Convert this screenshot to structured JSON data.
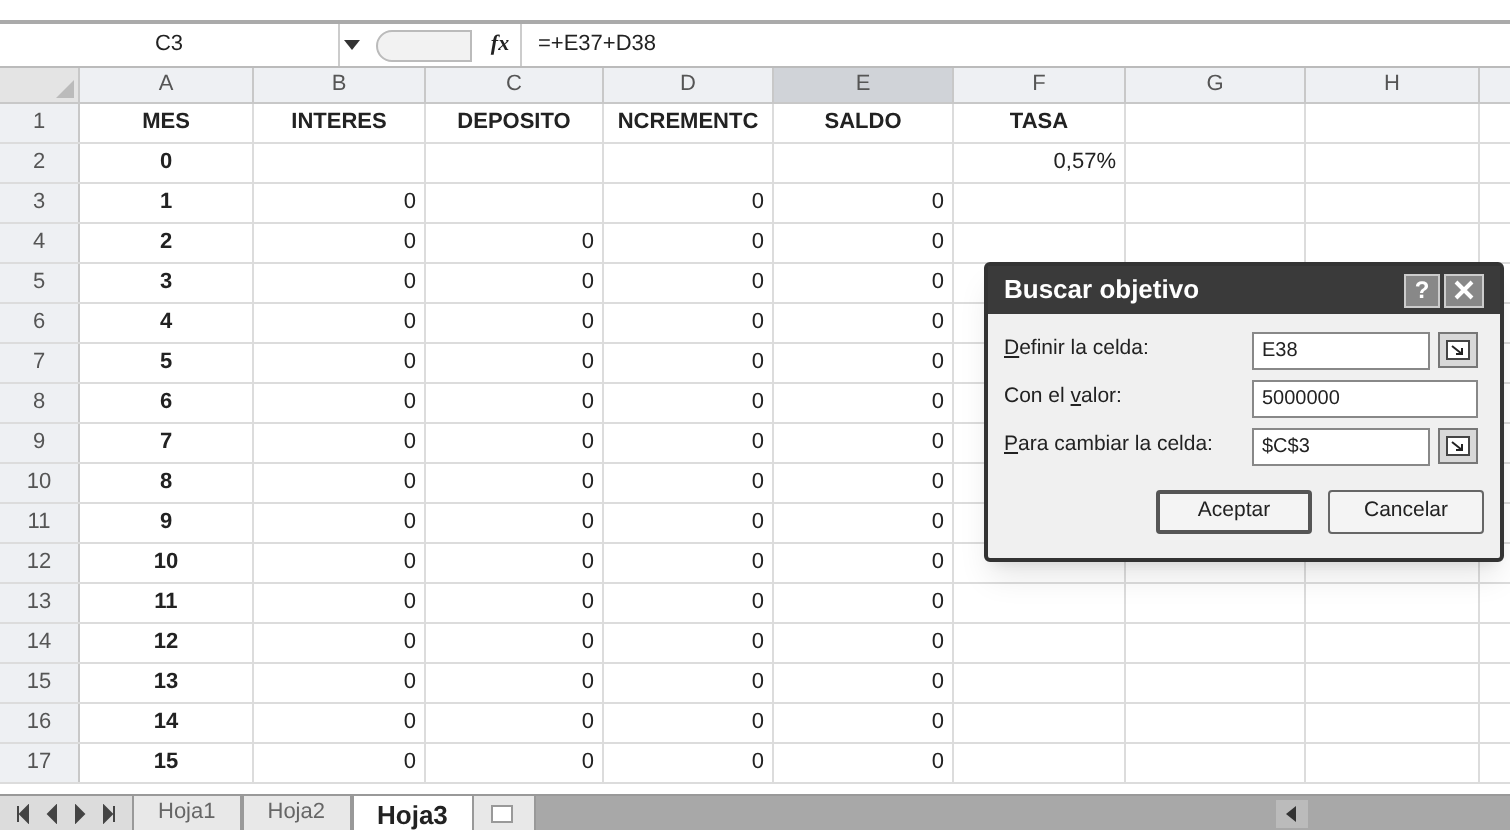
{
  "formula_bar": {
    "name_box": "C3",
    "function_label": "fx",
    "formula": "=+E37+D38"
  },
  "columns": [
    {
      "label": "A",
      "selected": false
    },
    {
      "label": "B",
      "selected": false
    },
    {
      "label": "C",
      "selected": false
    },
    {
      "label": "D",
      "selected": false
    },
    {
      "label": "E",
      "selected": true
    },
    {
      "label": "F",
      "selected": false
    },
    {
      "label": "G",
      "selected": false
    },
    {
      "label": "H",
      "selected": false
    }
  ],
  "rows": [
    {
      "number": "1",
      "cells": {
        "A": "MES",
        "B": "INTERES",
        "C": "DEPOSITO",
        "D": "NCREMENTC",
        "E": "SALDO",
        "F": "TASA"
      }
    },
    {
      "number": "2",
      "cells": {
        "A": "0",
        "F": "0,57%"
      }
    },
    {
      "number": "3",
      "cells": {
        "A": "1",
        "B": "0",
        "D": "0",
        "E": "0"
      }
    },
    {
      "number": "4",
      "cells": {
        "A": "2",
        "B": "0",
        "C": "0",
        "D": "0",
        "E": "0"
      }
    },
    {
      "number": "5",
      "cells": {
        "A": "3",
        "B": "0",
        "C": "0",
        "D": "0",
        "E": "0"
      }
    },
    {
      "number": "6",
      "cells": {
        "A": "4",
        "B": "0",
        "C": "0",
        "D": "0",
        "E": "0"
      }
    },
    {
      "number": "7",
      "cells": {
        "A": "5",
        "B": "0",
        "C": "0",
        "D": "0",
        "E": "0"
      }
    },
    {
      "number": "8",
      "cells": {
        "A": "6",
        "B": "0",
        "C": "0",
        "D": "0",
        "E": "0"
      }
    },
    {
      "number": "9",
      "cells": {
        "A": "7",
        "B": "0",
        "C": "0",
        "D": "0",
        "E": "0"
      }
    },
    {
      "number": "10",
      "cells": {
        "A": "8",
        "B": "0",
        "C": "0",
        "D": "0",
        "E": "0"
      }
    },
    {
      "number": "11",
      "cells": {
        "A": "9",
        "B": "0",
        "C": "0",
        "D": "0",
        "E": "0"
      }
    },
    {
      "number": "12",
      "cells": {
        "A": "10",
        "B": "0",
        "C": "0",
        "D": "0",
        "E": "0"
      }
    },
    {
      "number": "13",
      "cells": {
        "A": "11",
        "B": "0",
        "C": "0",
        "D": "0",
        "E": "0"
      }
    },
    {
      "number": "14",
      "cells": {
        "A": "12",
        "B": "0",
        "C": "0",
        "D": "0",
        "E": "0"
      }
    },
    {
      "number": "15",
      "cells": {
        "A": "13",
        "B": "0",
        "C": "0",
        "D": "0",
        "E": "0"
      }
    },
    {
      "number": "16",
      "cells": {
        "A": "14",
        "B": "0",
        "C": "0",
        "D": "0",
        "E": "0"
      }
    },
    {
      "number": "17",
      "cells": {
        "A": "15",
        "B": "0",
        "C": "0",
        "D": "0",
        "E": "0"
      }
    }
  ],
  "sheet_tabs": [
    {
      "label": "Hoja1",
      "selected": false
    },
    {
      "label": "Hoja2",
      "selected": false
    },
    {
      "label": "Hoja3",
      "selected": true
    }
  ],
  "dialog": {
    "title": "Buscar objetivo",
    "help": "?",
    "fields": [
      {
        "key": "D",
        "post": "efinir la celda:",
        "value": "E38",
        "ref_button": true
      },
      {
        "pre": "Con el ",
        "key": "v",
        "post": "alor:",
        "value": "5000000",
        "ref_button": false
      },
      {
        "key": "P",
        "post": "ara cambiar la celda:",
        "value": "$C$3",
        "ref_button": true
      }
    ],
    "buttons": [
      "Aceptar",
      "Cancelar"
    ]
  }
}
